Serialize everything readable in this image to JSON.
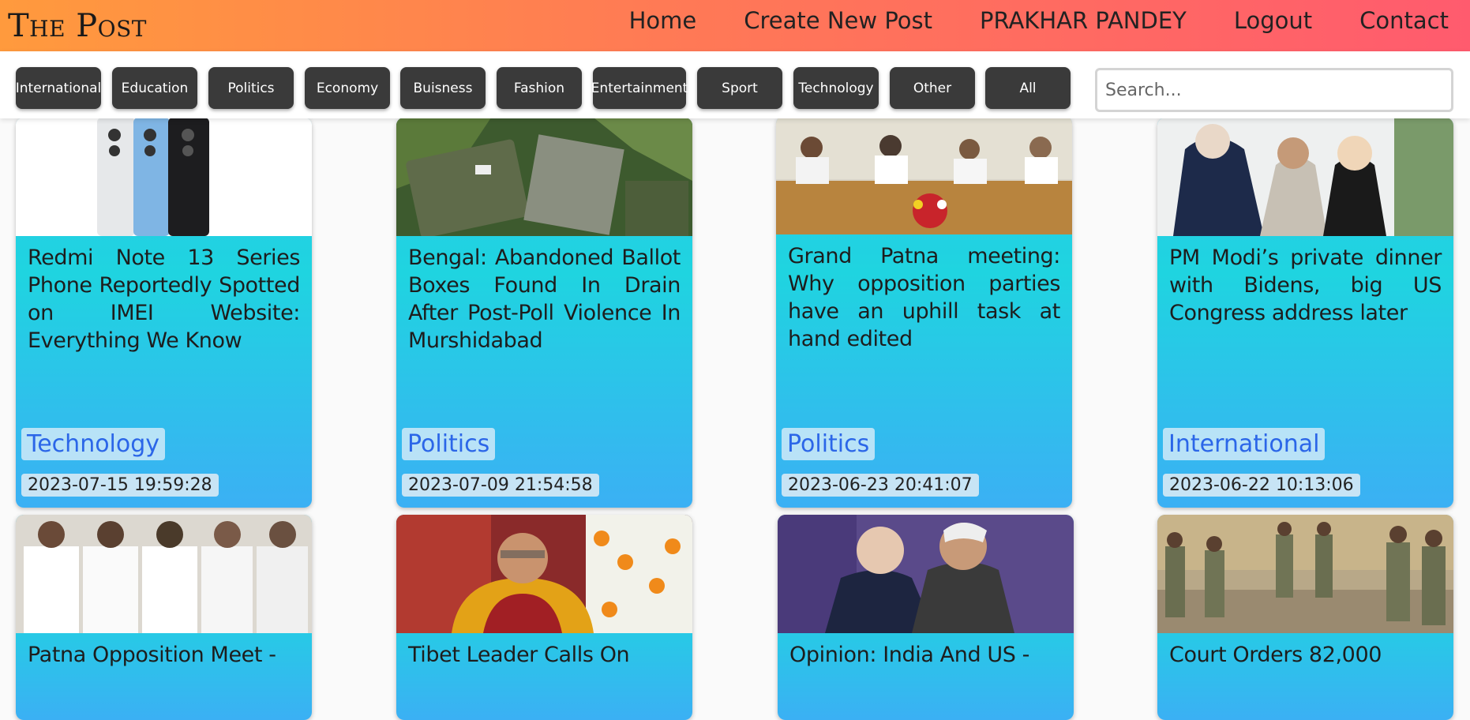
{
  "navbar": {
    "brand": "The Post",
    "links": [
      "Home",
      "Create New Post",
      "PRAKHAR PANDEY",
      "Logout",
      "Contact"
    ]
  },
  "categories": [
    "International",
    "Education",
    "Politics",
    "Economy",
    "Buisness",
    "Fashion",
    "Entertainment",
    "Sport",
    "Technology",
    "Other",
    "All"
  ],
  "search": {
    "placeholder": "Search..."
  },
  "posts": [
    {
      "title": "Redmi Note 13 Series Phone Reportedly Spotted on IMEI Website: Everything We Know",
      "category": "Technology",
      "date": "2023-07-15 19:59:28",
      "image": "phones-image"
    },
    {
      "title": "Bengal: Abandoned Ballot Boxes Found In Drain After Post-Poll Violence In Murshidabad",
      "category": "Politics",
      "date": "2023-07-09 21:54:58",
      "image": "ballot-boxes-image"
    },
    {
      "title": "Grand Patna meeting: Why opposition parties have an uphill task at hand edited",
      "category": "Politics",
      "date": "2023-06-23 20:41:07",
      "image": "meeting-image"
    },
    {
      "title": "PM Modi’s private dinner with Bidens, big US Congress address later",
      "category": "International",
      "date": "2023-06-22 10:13:06",
      "image": "dinner-image"
    },
    {
      "title": "Patna Opposition Meet -",
      "image": "leaders-image"
    },
    {
      "title": "Tibet Leader Calls On",
      "image": "dalai-lama-image"
    },
    {
      "title": "Opinion: India And US -",
      "image": "biden-modi-image"
    },
    {
      "title": "Court Orders 82,000",
      "image": "security-forces-image"
    }
  ]
}
